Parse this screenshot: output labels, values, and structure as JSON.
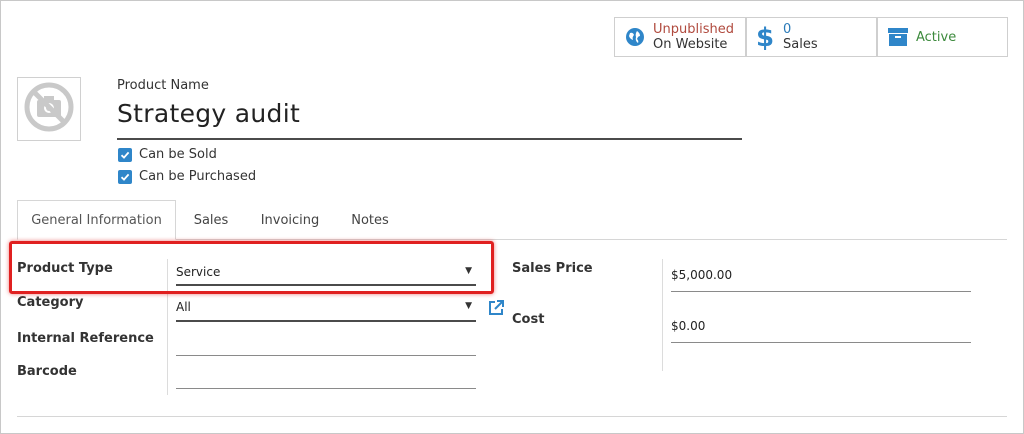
{
  "smart_buttons": {
    "website": {
      "line1": "Unpublished",
      "line2": "On Website",
      "icon": "globe-icon"
    },
    "sales": {
      "count": "0",
      "label": "Sales",
      "icon": "dollar-icon"
    },
    "active": {
      "label": "Active",
      "icon": "archive-icon"
    }
  },
  "product": {
    "name_label": "Product Name",
    "name": "Strategy audit",
    "image_icon": "no-camera-icon",
    "can_be_sold": "Can be Sold",
    "can_be_purchased": "Can be Purchased"
  },
  "tabs": [
    "General Information",
    "Sales",
    "Invoicing",
    "Notes"
  ],
  "form": {
    "product_type": {
      "label": "Product Type",
      "value": "Service"
    },
    "category": {
      "label": "Category",
      "value": "All"
    },
    "internal_reference": {
      "label": "Internal Reference",
      "value": ""
    },
    "barcode": {
      "label": "Barcode",
      "value": ""
    },
    "sales_price": {
      "label": "Sales Price",
      "value": "$5,000.00"
    },
    "cost": {
      "label": "Cost",
      "value": "$0.00"
    }
  },
  "colors": {
    "accent_blue": "#2f86c9",
    "unpublished_red": "#b04a3e",
    "active_green": "#3c8a3c",
    "highlight_red": "#e02020"
  }
}
